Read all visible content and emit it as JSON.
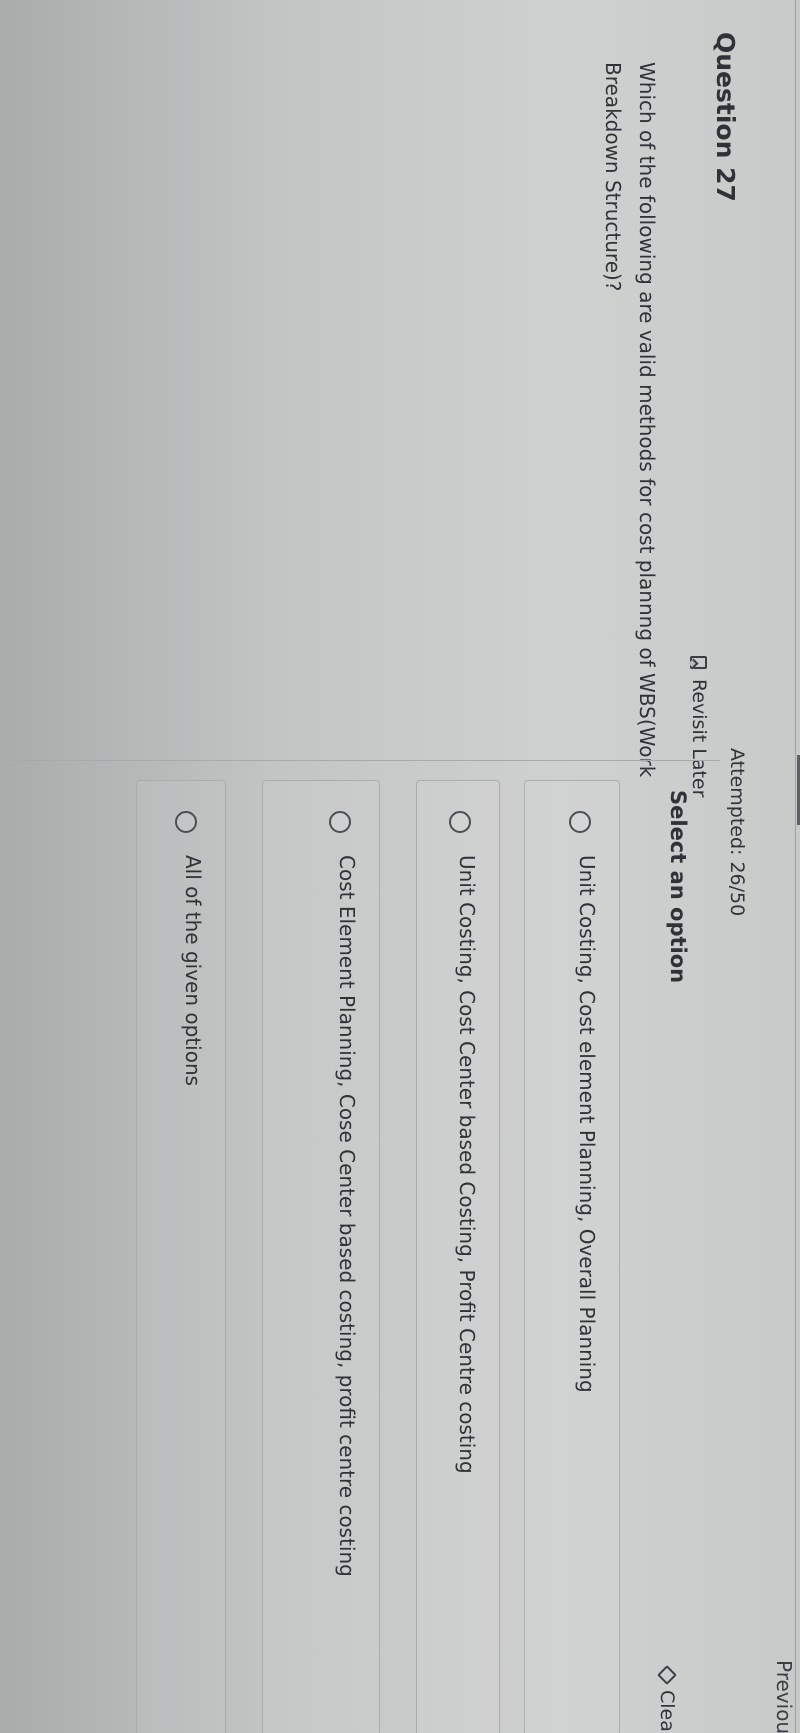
{
  "header": {
    "previous_label": "Previou",
    "attempted_text": "Attempted: 26/50"
  },
  "question": {
    "number_label": "Question 27",
    "revisit_label": "Revisit Later",
    "text": "Which of the following are valid methods for cost plannng of WBS(Work Breakdown Structure)?"
  },
  "answers": {
    "heading": "Select an option",
    "clear_label": "Clear",
    "options": [
      {
        "label": "Unit Costing, Cost element Planning, Overall Planning",
        "selected": false
      },
      {
        "label": "Unit Costing, Cost Center based Costing, Profit Centre costing",
        "selected": false
      },
      {
        "label": "Cost Element Planning, Cose Center based costing, profit centre costing",
        "selected": false
      },
      {
        "label": "All of the given options",
        "selected": false
      }
    ]
  },
  "icons": {
    "revisit": "bookmark-icon",
    "clear": "eraser-icon",
    "option": "radio-icon"
  }
}
